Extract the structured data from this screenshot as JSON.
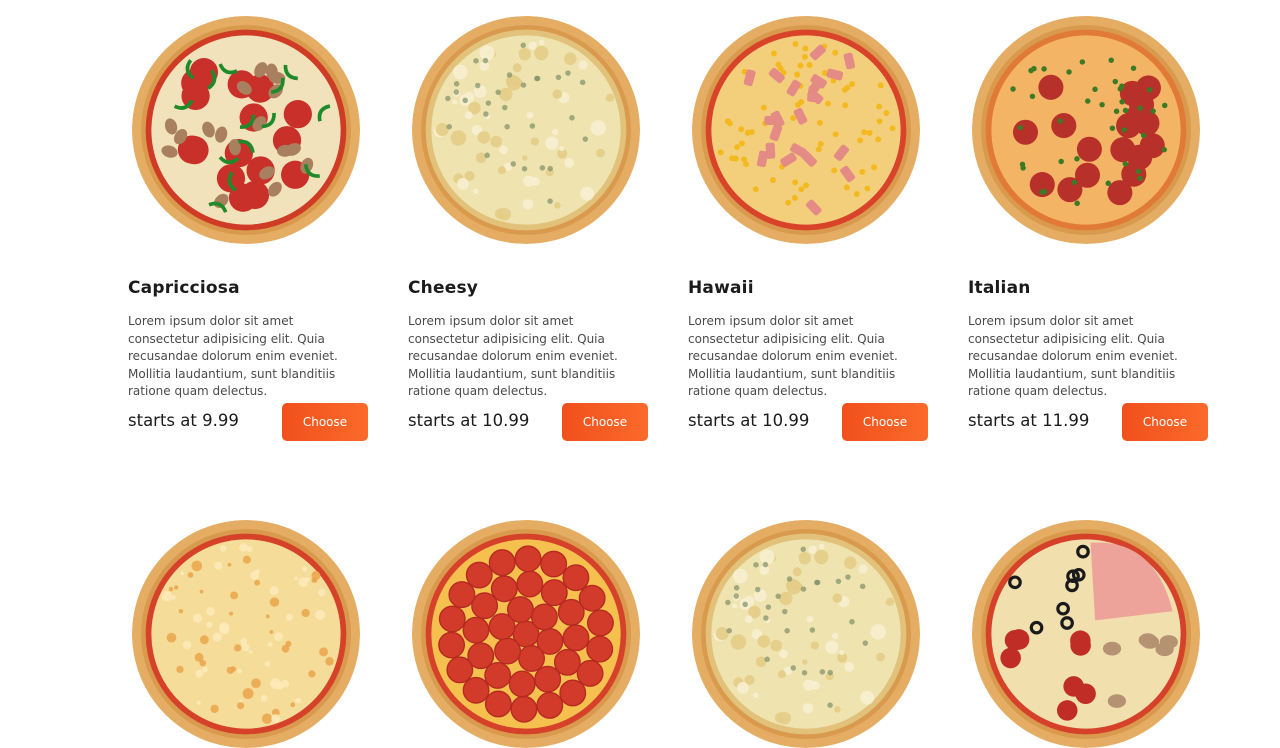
{
  "row1": [
    {
      "name": "Capricciosa",
      "desc": "Lorem ipsum dolor sit amet consectetur adipisicing elit. Quia recusandae dolorum enim eveniet. Mollitia laudantium, sunt blanditiis ratione quam delectus.",
      "price": "starts at 9.99",
      "button": "Choose",
      "topping": "pepperoni-pepper-mushroom"
    },
    {
      "name": "Cheesy",
      "desc": "Lorem ipsum dolor sit amet consectetur adipisicing elit. Quia recusandae dolorum enim eveniet. Mollitia laudantium, sunt blanditiis ratione quam delectus.",
      "price": "starts at 10.99",
      "button": "Choose",
      "topping": "four-cheese"
    },
    {
      "name": "Hawaii",
      "desc": "Lorem ipsum dolor sit amet consectetur adipisicing elit. Quia recusandae dolorum enim eveniet. Mollitia laudantium, sunt blanditiis ratione quam delectus.",
      "price": "starts at 10.99",
      "button": "Choose",
      "topping": "ham-corn"
    },
    {
      "name": "Italian",
      "desc": "Lorem ipsum dolor sit amet consectetur adipisicing elit. Quia recusandae dolorum enim eveniet. Mollitia laudantium, sunt blanditiis ratione quam delectus.",
      "price": "starts at 11.99",
      "button": "Choose",
      "topping": "salami-herbs"
    }
  ],
  "row2": [
    {
      "topping": "margherita"
    },
    {
      "topping": "pepperoni"
    },
    {
      "topping": "four-cheese"
    },
    {
      "topping": "quattro-stagioni"
    }
  ],
  "colors": {
    "accent": "#f4541f",
    "crust": "#e8b56e",
    "sauce": "#d8432a",
    "cheese": "#f4dc9a",
    "pepperoni": "#c8342a"
  }
}
